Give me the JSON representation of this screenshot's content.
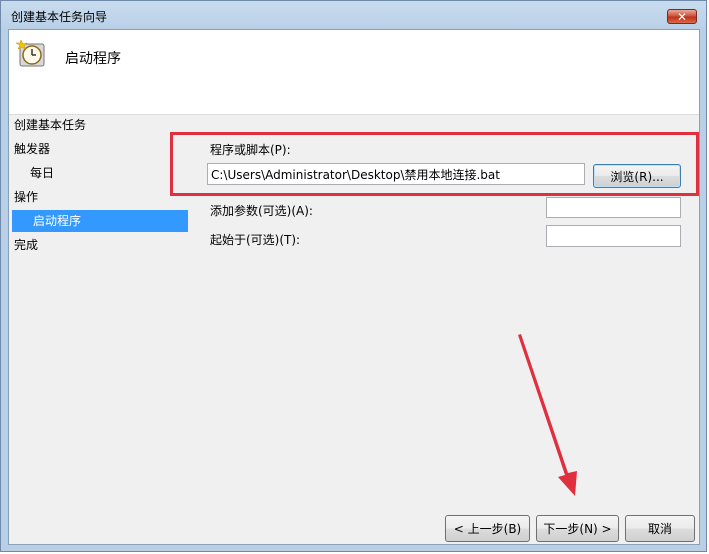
{
  "window": {
    "title": "创建基本任务向导",
    "close_label": "✕"
  },
  "header": {
    "title": "启动程序",
    "icon": "clock-icon"
  },
  "nav": {
    "items": [
      {
        "label": "创建基本任务"
      },
      {
        "label": "触发器"
      },
      {
        "label": "每日"
      },
      {
        "label": "操作"
      },
      {
        "label": "启动程序"
      },
      {
        "label": "完成"
      }
    ]
  },
  "form": {
    "program_label": "程序或脚本(P):",
    "program_value": "C:\\Users\\Administrator\\Desktop\\禁用本地连接.bat",
    "browse_label": "浏览(R)...",
    "args_label": "添加参数(可选)(A):",
    "args_value": "",
    "start_in_label": "起始于(可选)(T):",
    "start_in_value": ""
  },
  "footer": {
    "back_label": "< 上一步(B)",
    "next_label": "下一步(N) >",
    "cancel_label": "取消"
  },
  "colors": {
    "selection": "#3399ff",
    "highlight_box": "#e03040",
    "arrow": "#e03040"
  }
}
